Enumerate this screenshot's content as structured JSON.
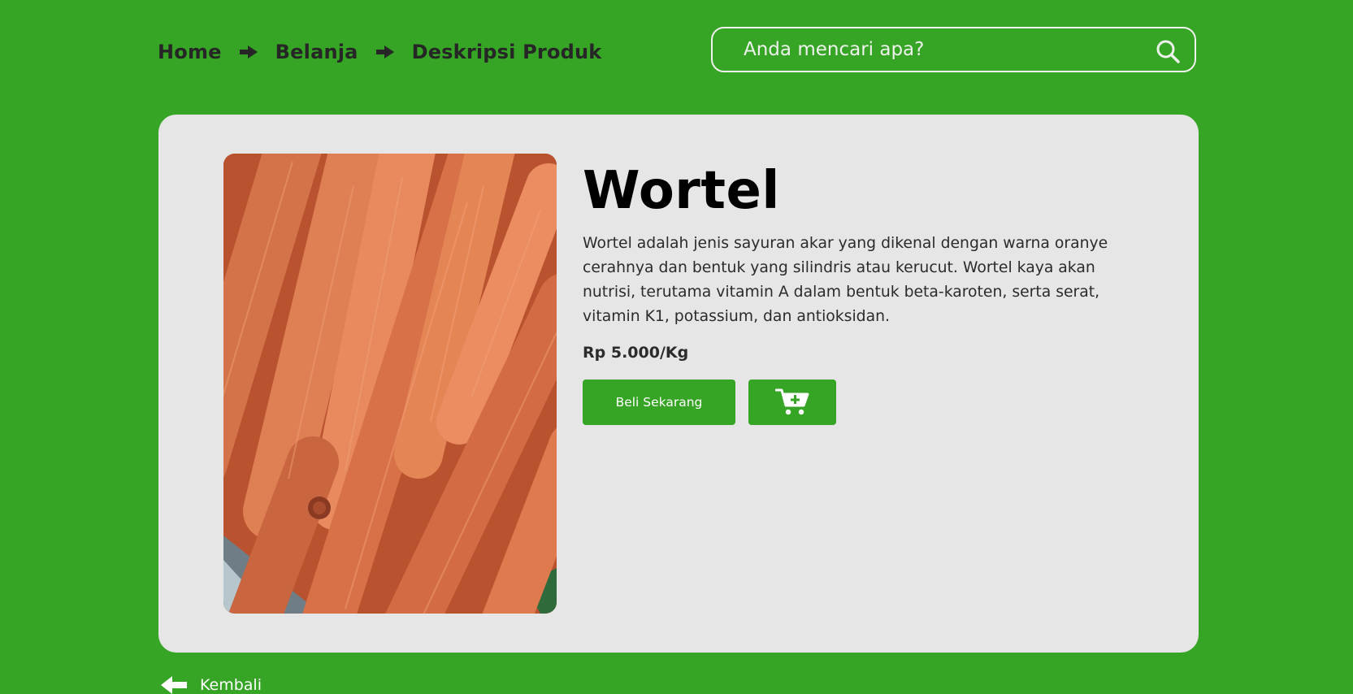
{
  "breadcrumb": {
    "items": [
      {
        "label": "Home"
      },
      {
        "label": "Belanja"
      },
      {
        "label": "Deskripsi Produk"
      }
    ]
  },
  "search": {
    "placeholder": "Anda mencari apa?",
    "icon": "search-icon"
  },
  "product": {
    "name": "Wortel",
    "description": "Wortel adalah jenis sayuran akar yang dikenal dengan warna oranye cerahnya dan bentuk yang silindris atau kerucut. Wortel kaya akan nutrisi, terutama vitamin A dalam bentuk beta-karoten, serta serat, vitamin K1, potassium, dan antioksidan.",
    "price": "Rp 5.000/Kg",
    "image": "carrots-photo",
    "buy_label": "Beli Sekarang",
    "cart_icon": "cart-plus-icon"
  },
  "back": {
    "label": "Kembali",
    "icon": "arrow-left-icon"
  },
  "colors": {
    "background": "#36a424",
    "card": "#e6e6e6",
    "button": "#36a424",
    "text": "#262626"
  }
}
